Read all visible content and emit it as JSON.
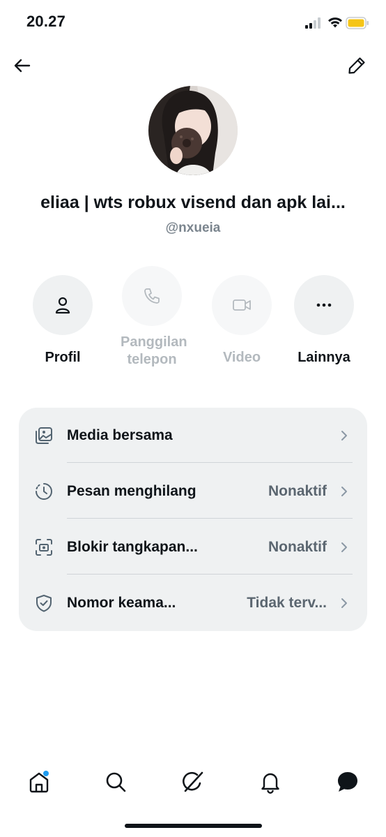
{
  "status_bar": {
    "time": "20.27"
  },
  "profile": {
    "display_name": "eliaa | wts robux visend dan apk lai...",
    "handle": "@nxueia"
  },
  "actions": [
    {
      "label": "Profil",
      "icon": "person-icon",
      "enabled": true
    },
    {
      "label": "Panggilan telepon",
      "icon": "phone-icon",
      "enabled": false
    },
    {
      "label": "Video",
      "icon": "video-icon",
      "enabled": false
    },
    {
      "label": "Lainnya",
      "icon": "more-icon",
      "enabled": true
    }
  ],
  "settings": [
    {
      "label": "Media bersama",
      "value": "",
      "icon": "media-icon"
    },
    {
      "label": "Pesan menghilang",
      "value": "Nonaktif",
      "icon": "timer-icon"
    },
    {
      "label": "Blokir tangkapan...",
      "value": "Nonaktif",
      "icon": "screenshot-icon"
    },
    {
      "label": "Nomor keama...",
      "value": "Tidak terv...",
      "icon": "shield-icon"
    }
  ],
  "bottom_nav": [
    {
      "name": "home",
      "icon": "home-icon",
      "notification_dot": true
    },
    {
      "name": "search",
      "icon": "search-icon"
    },
    {
      "name": "grok",
      "icon": "grok-icon"
    },
    {
      "name": "notifications",
      "icon": "bell-icon"
    },
    {
      "name": "messages",
      "icon": "chat-icon"
    }
  ],
  "colors": {
    "notification_dot": "#1d9bf0",
    "battery": "#f5c518"
  }
}
